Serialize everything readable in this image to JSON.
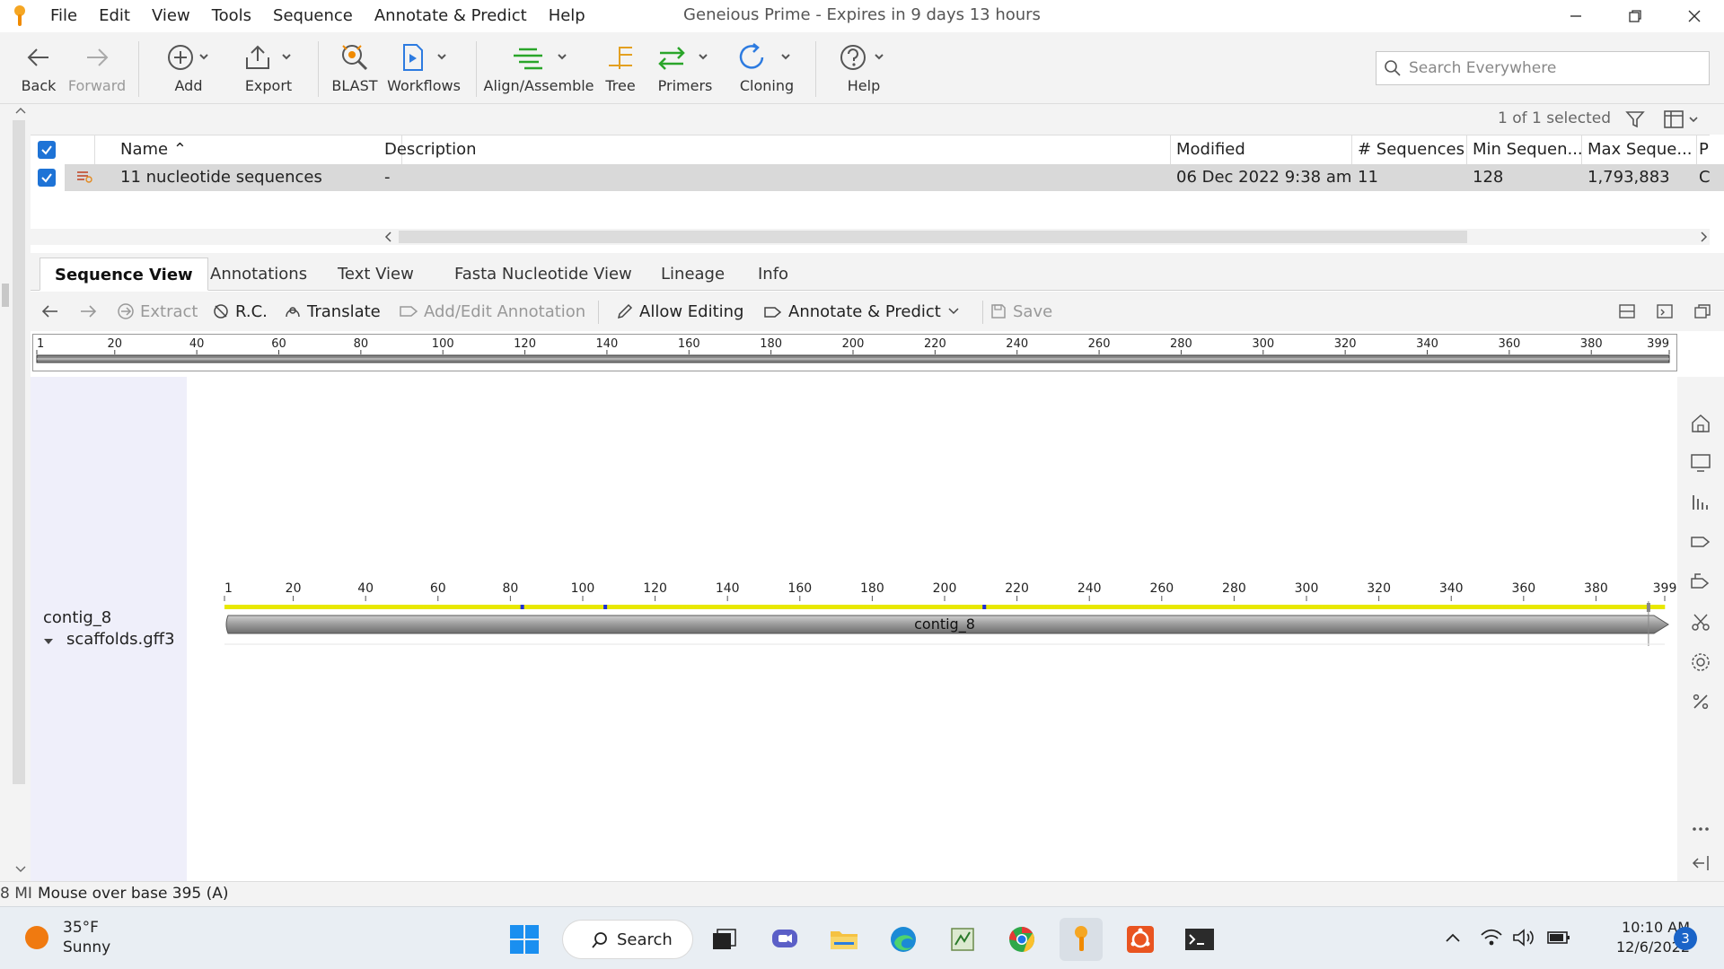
{
  "menubar": {
    "items": [
      "File",
      "Edit",
      "View",
      "Tools",
      "Sequence",
      "Annotate & Predict",
      "Help"
    ],
    "title": "Geneious Prime - Expires in 9 days 13 hours"
  },
  "toolbar": {
    "back": "Back",
    "forward": "Forward",
    "add": "Add",
    "export": "Export",
    "blast": "BLAST",
    "workflows": "Workflows",
    "align": "Align/Assemble",
    "tree": "Tree",
    "primers": "Primers",
    "cloning": "Cloning",
    "help": "Help",
    "search_placeholder": "Search Everywhere"
  },
  "documents": {
    "selected_count": "1 of 1 selected",
    "columns": [
      "Name",
      "Description",
      "Modified",
      "# Sequences",
      "Min Sequen...",
      "Max Seque...",
      "P"
    ],
    "row": {
      "name": "11 nucleotide sequences",
      "description": "-",
      "modified": "06 Dec 2022 9:38 am",
      "sequences": "11",
      "min": "128",
      "max": "1,793,883",
      "p": "C"
    }
  },
  "tabs": [
    "Sequence View",
    "Annotations",
    "Text View",
    "Fasta Nucleotide View",
    "Lineage",
    "Info"
  ],
  "viewer_toolbar": {
    "extract": "Extract",
    "rc": "R.C.",
    "translate": "Translate",
    "add_edit": "Add/Edit Annotation",
    "allow_editing": "Allow Editing",
    "annotate_predict": "Annotate & Predict",
    "save": "Save"
  },
  "ruler": {
    "ticks": [
      "1",
      "20",
      "40",
      "60",
      "80",
      "100",
      "120",
      "140",
      "160",
      "180",
      "200",
      "220",
      "240",
      "260",
      "280",
      "300",
      "320",
      "340",
      "360",
      "380",
      "399"
    ]
  },
  "sequence": {
    "name": "contig_8",
    "track_name": "scaffolds.gff3",
    "annotation_label": "contig_8",
    "length": 399,
    "hover_base": 395
  },
  "status": {
    "left": "8 MI",
    "text": "Mouse over base 395 (A)"
  },
  "taskbar": {
    "temp": "35°F",
    "condition": "Sunny",
    "search": "Search",
    "time": "10:10 AM",
    "date": "12/6/2022",
    "notifications": "3"
  },
  "colors": {
    "accent": "#1e73d6",
    "base_A": "#e8e800",
    "base_C": "#1f2fd6",
    "base_G": "#16c816",
    "base_T": "#e01010"
  }
}
